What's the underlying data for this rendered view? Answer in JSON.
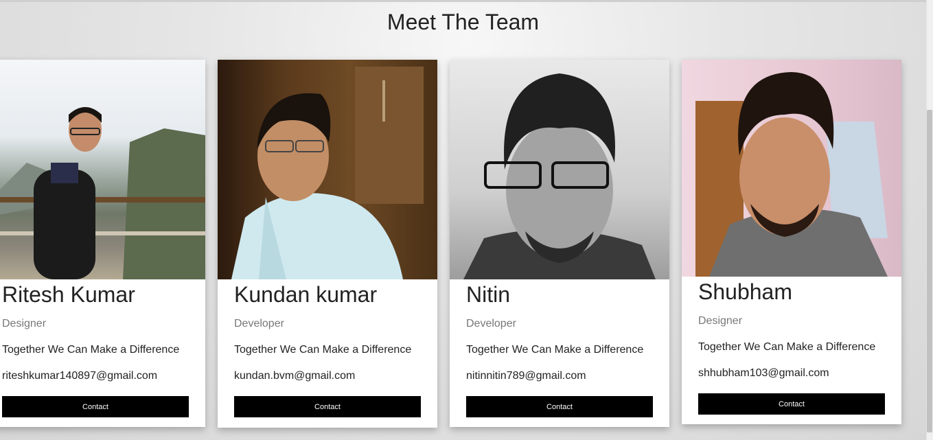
{
  "page": {
    "title": "Meet The Team"
  },
  "team": [
    {
      "name": "Ritesh Kumar",
      "role": "Designer",
      "quote": "Together We Can Make a Difference",
      "email": "riteshkumar140897@gmail.com",
      "button": "Contact"
    },
    {
      "name": "Kundan kumar",
      "role": "Developer",
      "quote": "Together We Can Make a Difference",
      "email": "kundan.bvm@gmail.com",
      "button": "Contact"
    },
    {
      "name": "Nitin",
      "role": "Developer",
      "quote": "Together We Can Make a Difference",
      "email": "nitinnitin789@gmail.com",
      "button": "Contact"
    },
    {
      "name": "Shubham",
      "role": "Designer",
      "quote": "Together We Can Make a Difference",
      "email": "shhubham103@gmail.com",
      "button": "Contact"
    }
  ]
}
